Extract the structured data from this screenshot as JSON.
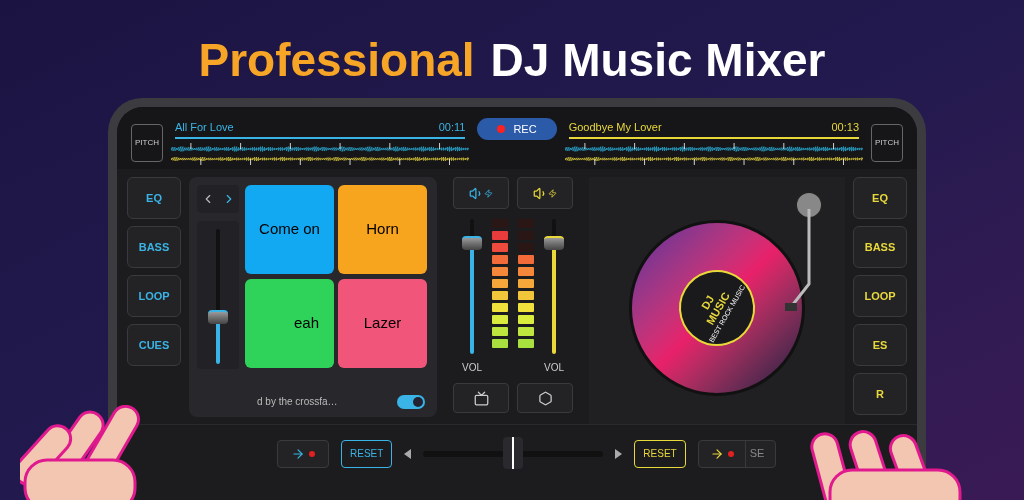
{
  "headline": {
    "accent": "Professional",
    "rest": "DJ Music Mixer"
  },
  "deck_a": {
    "pitch": "PITCH",
    "track": "All For Love",
    "time": "00:11",
    "color": "#3ab4e6"
  },
  "rec": {
    "label": "REC"
  },
  "deck_b": {
    "pitch": "PITCH",
    "track": "Goodbye My Lover",
    "time": "00:13",
    "color": "#e8d83a"
  },
  "left_buttons": [
    "EQ",
    "BASS",
    "LOOP",
    "CUES"
  ],
  "pads": [
    {
      "label": "Come on",
      "color": "#12a9f2"
    },
    {
      "label": "Horn",
      "color": "#f7a41f"
    },
    {
      "label": "eah",
      "color": "#2fd35a"
    },
    {
      "label": "Lazer",
      "color": "#f2557a"
    }
  ],
  "sampler_fader": {
    "level": 0.35
  },
  "crossfader_note": {
    "text": "d by the crossfa…",
    "on": true
  },
  "volume_faders": [
    {
      "label": "VOL",
      "level": 0.82,
      "color": "#3ab4e6"
    },
    {
      "label": "VOL",
      "level": 0.82,
      "color": "#e8d83a"
    }
  ],
  "meters": [
    {
      "level": 0.91
    },
    {
      "level": 0.73
    }
  ],
  "disc": {
    "title": "DJ MUSIC",
    "subtitle": "BEST ROCK MUSIC"
  },
  "right_buttons": [
    "EQ",
    "BASS",
    "LOOP",
    "ES",
    "R"
  ],
  "bottom_bar": {
    "left_reset": "RESET",
    "crossfader": {
      "level": 0.5
    },
    "right_reset": "RESET",
    "right_partial": "SE"
  }
}
